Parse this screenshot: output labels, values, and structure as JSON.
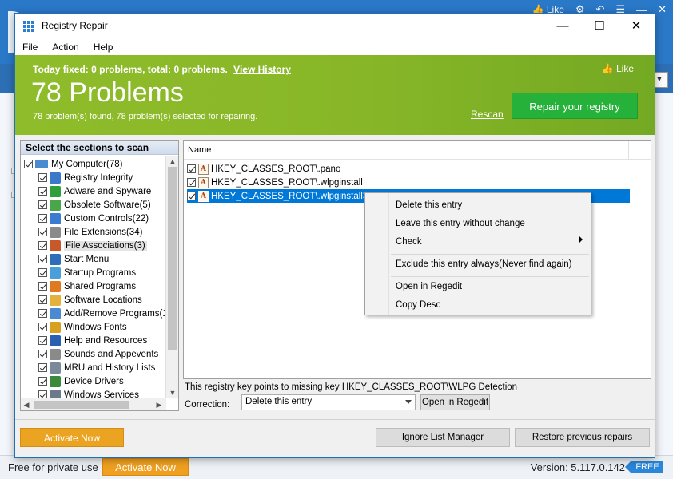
{
  "background_app": {
    "like_label": "Like",
    "footer_free": "Free for private use",
    "footer_activate": "Activate Now",
    "footer_version": "Version: 5.117.0.142",
    "footer_badge": "FREE"
  },
  "window": {
    "title": "Registry Repair",
    "minimize_glyph": "—",
    "maximize_glyph": "☐",
    "close_glyph": "✕"
  },
  "menu": [
    "File",
    "Action",
    "Help"
  ],
  "header": {
    "status": "Today fixed: 0 problems, total: 0 problems.",
    "view_history": "View History",
    "problems": "78 Problems",
    "found": "78 problem(s) found, 78 problem(s) selected for repairing.",
    "like": "Like",
    "rescan": "Rescan",
    "repair_button": "Repair your registry",
    "accent_color": "#8fbc2a",
    "repair_color": "#25b13a"
  },
  "sections": {
    "header": "Select the sections to scan",
    "root": "My Computer(78)",
    "items": [
      {
        "label": "Registry Integrity",
        "icon": "registry-integrity-icon",
        "color": "#3a78c8"
      },
      {
        "label": "Adware and Spyware",
        "icon": "shield-icon",
        "color": "#2f9e3c"
      },
      {
        "label": "Obsolete Software(5)",
        "icon": "recycle-bin-icon",
        "color": "#4aa64a"
      },
      {
        "label": "Custom Controls(22)",
        "icon": "controls-icon",
        "color": "#3b7bd0"
      },
      {
        "label": "File Extensions(34)",
        "icon": "file-icon",
        "color": "#8a8a8a"
      },
      {
        "label": "File Associations(3)",
        "icon": "file-association-icon",
        "color": "#c8582a"
      },
      {
        "label": "Start Menu",
        "icon": "start-menu-icon",
        "color": "#2f6db8"
      },
      {
        "label": "Startup Programs",
        "icon": "startup-icon",
        "color": "#4a9fd8"
      },
      {
        "label": "Shared Programs",
        "icon": "shared-programs-icon",
        "color": "#e07a20"
      },
      {
        "label": "Software Locations",
        "icon": "folder-icon",
        "color": "#e3b23c"
      },
      {
        "label": "Add/Remove Programs(1",
        "icon": "add-remove-icon",
        "color": "#4a8ad0"
      },
      {
        "label": "Windows Fonts",
        "icon": "font-icon",
        "color": "#d8a020"
      },
      {
        "label": "Help and Resources",
        "icon": "help-icon",
        "color": "#2b5fb0"
      },
      {
        "label": "Sounds and Appevents",
        "icon": "sound-icon",
        "color": "#8a8a8a"
      },
      {
        "label": "MRU and History Lists",
        "icon": "history-icon",
        "color": "#7a8a9a"
      },
      {
        "label": "Device Drivers",
        "icon": "driver-icon",
        "color": "#3a8a3a"
      },
      {
        "label": "Windows Services",
        "icon": "services-icon",
        "color": "#6a7a8a"
      }
    ]
  },
  "list": {
    "column_name": "Name",
    "rows": [
      "HKEY_CLASSES_ROOT\\.pano",
      "HKEY_CLASSES_ROOT\\.wlpginstall",
      "HKEY_CLASSES_ROOT\\.wlpginstall3"
    ],
    "row_icon_glyph": "A"
  },
  "context_menu": {
    "items": [
      "Delete this entry",
      "Leave this entry without change",
      "Check",
      "Exclude this entry always(Never find again)",
      "Open in Regedit",
      "Copy Desc"
    ]
  },
  "detail": {
    "description": "This registry key points to missing key HKEY_CLASSES_ROOT\\WLPG Detection",
    "correction_label": "Correction:",
    "correction_value": "Delete this entry",
    "open_regedit": "Open in Regedit"
  },
  "bottom": {
    "activate": "Activate Now",
    "ignore_list": "Ignore List Manager",
    "restore": "Restore previous repairs"
  }
}
